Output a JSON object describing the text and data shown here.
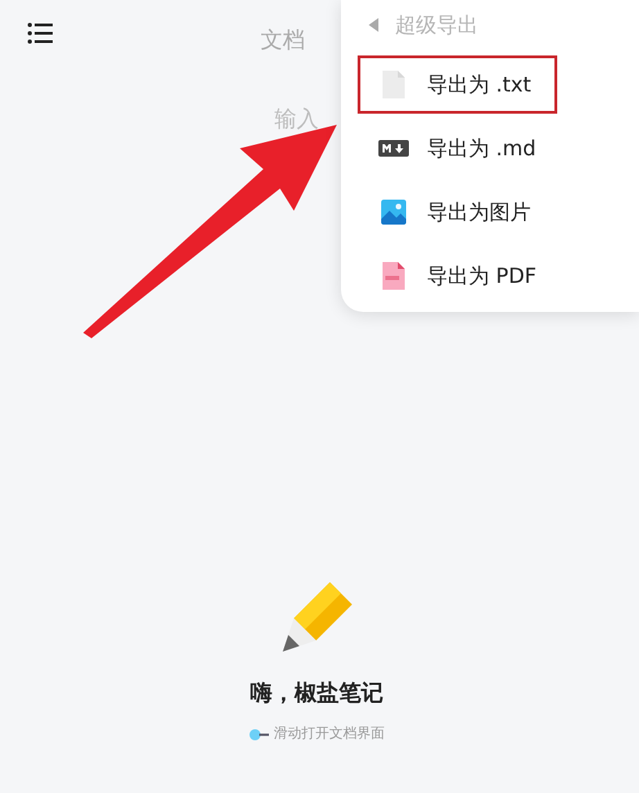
{
  "header": {
    "tab": "文档",
    "title_placeholder": "输入"
  },
  "export_menu": {
    "title": "超级导出",
    "items": [
      {
        "kind": "txt",
        "label": "导出为 .txt",
        "highlighted": true
      },
      {
        "kind": "md",
        "label": "导出为 .md",
        "highlighted": false
      },
      {
        "kind": "image",
        "label": "导出为图片",
        "highlighted": false
      },
      {
        "kind": "pdf",
        "label": "导出为 PDF",
        "highlighted": false
      }
    ]
  },
  "empty_state": {
    "title": "嗨，椒盐笔记",
    "hint": "滑动打开文档界面"
  }
}
